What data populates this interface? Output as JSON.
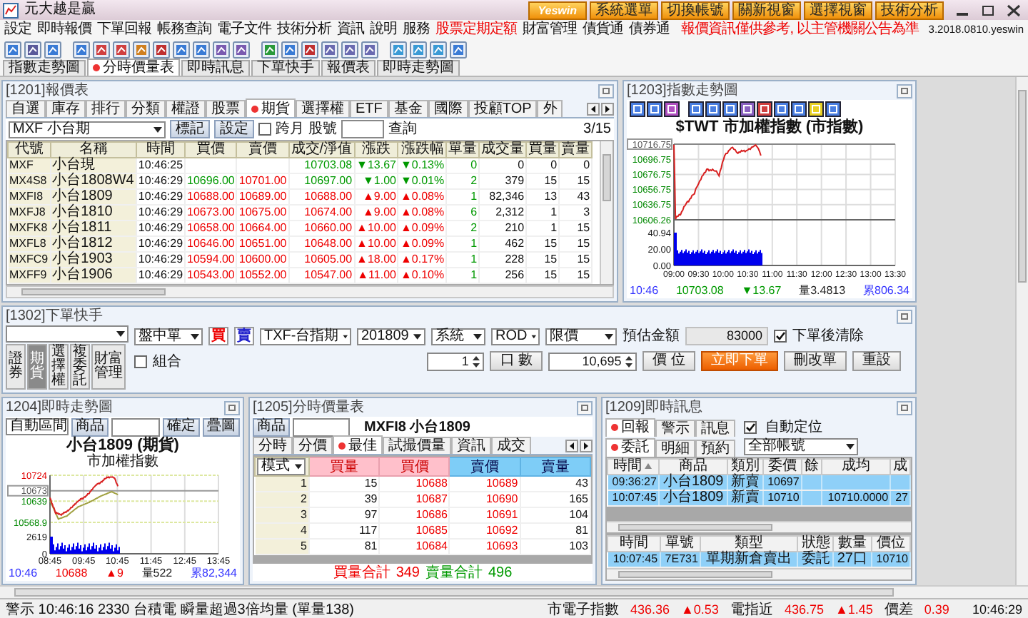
{
  "window": {
    "title": "元大越是贏",
    "logo": "Yeswin",
    "buttons": [
      "系統選單",
      "切換帳號",
      "關新視窗",
      "選擇視窗",
      "技術分析"
    ]
  },
  "menu": [
    {
      "label": "設定",
      "highlight": false
    },
    {
      "label": "即時報價",
      "highlight": false
    },
    {
      "label": "下單回報",
      "highlight": false
    },
    {
      "label": "帳務查詢",
      "highlight": false
    },
    {
      "label": "電子文件",
      "highlight": false
    },
    {
      "label": "技術分析",
      "highlight": false
    },
    {
      "label": "資訊",
      "highlight": false
    },
    {
      "label": "說明",
      "highlight": false
    },
    {
      "label": "服務",
      "highlight": false
    },
    {
      "label": "股票定期定額",
      "highlight": true
    },
    {
      "label": "財富管理",
      "highlight": false
    },
    {
      "label": "債貨通",
      "highlight": false
    },
    {
      "label": "債券通",
      "highlight": false
    }
  ],
  "notice": "報價資訊僅供參考, 以主管機關公告為準",
  "version": "3.2018.0810.yeswin",
  "doc_tabs": [
    {
      "label": "指數走勢圖",
      "selected": false
    },
    {
      "label": "分時價量表",
      "selected": true
    },
    {
      "label": "即時訊息",
      "selected": false
    },
    {
      "label": "下單快手",
      "selected": false
    },
    {
      "label": "報價表",
      "selected": false
    },
    {
      "label": "即時走勢圖",
      "selected": false
    }
  ],
  "quote_panel": {
    "title": "[1201]報價表",
    "tabs": [
      {
        "label": "自選",
        "selected": false
      },
      {
        "label": "庫存",
        "selected": false
      },
      {
        "label": "排行",
        "selected": false
      },
      {
        "label": "分類",
        "selected": false
      },
      {
        "label": "權證",
        "selected": false
      },
      {
        "label": "股票",
        "selected": false
      },
      {
        "label": "期貨",
        "selected": true
      },
      {
        "label": "選擇權",
        "selected": false
      },
      {
        "label": "ETF",
        "selected": false
      },
      {
        "label": "基金",
        "selected": false
      },
      {
        "label": "國際",
        "selected": false
      },
      {
        "label": "投顧TOP",
        "selected": false
      },
      {
        "label": "外",
        "selected": false
      }
    ],
    "product": "MXF 小台期",
    "buttons": [
      "標記",
      "設定"
    ],
    "cross_month": {
      "label": "跨月",
      "checked": false
    },
    "stock_label": "股號",
    "query": "查詢",
    "page": "3/15",
    "columns": [
      "代號",
      "名稱",
      "時間",
      "買價",
      "賣價",
      "成交/淨值",
      "漲跌",
      "漲跌幅",
      "單量",
      "成交量",
      "買量",
      "賣量"
    ],
    "rows": [
      {
        "code": "MXF",
        "name": "小台現",
        "time": "10:46:25",
        "last": "10703.08",
        "change": "▼13.67",
        "change_pct": "▼0.13%",
        "tick_vol": "0",
        "volume": "0",
        "bid_vol": "0",
        "ask_vol": "0",
        "up": false
      },
      {
        "code": "MX4S8",
        "name": "小台1808W4",
        "time": "10:46:29",
        "bid": "10696.00",
        "ask": "10701.00",
        "last": "10697.00",
        "change": "▼1.00",
        "change_pct": "▼0.01%",
        "tick_vol": "2",
        "volume": "379",
        "bid_vol": "15",
        "ask_vol": "15",
        "up": false,
        "bid_up": false,
        "ask_up": true
      },
      {
        "code": "MXFI8",
        "name": "小台1809",
        "time": "10:46:29",
        "bid": "10688.00",
        "ask": "10689.00",
        "last": "10688.00",
        "change": "▲9.00",
        "change_pct": "▲0.08%",
        "tick_vol": "1",
        "volume": "82,346",
        "bid_vol": "13",
        "ask_vol": "43",
        "up": true,
        "bid_up": true,
        "ask_up": true
      },
      {
        "code": "MXFJ8",
        "name": "小台1810",
        "time": "10:46:29",
        "bid": "10673.00",
        "ask": "10675.00",
        "last": "10674.00",
        "change": "▲9.00",
        "change_pct": "▲0.08%",
        "tick_vol": "6",
        "volume": "2,312",
        "bid_vol": "1",
        "ask_vol": "3",
        "up": true,
        "bid_up": true,
        "ask_up": true
      },
      {
        "code": "MXFK8",
        "name": "小台1811",
        "time": "10:46:29",
        "bid": "10658.00",
        "ask": "10664.00",
        "last": "10660.00",
        "change": "▲10.00",
        "change_pct": "▲0.09%",
        "tick_vol": "2",
        "volume": "210",
        "bid_vol": "1",
        "ask_vol": "15",
        "up": true,
        "bid_up": true,
        "ask_up": true
      },
      {
        "code": "MXFL8",
        "name": "小台1812",
        "time": "10:46:29",
        "bid": "10646.00",
        "ask": "10651.00",
        "last": "10648.00",
        "change": "▲10.00",
        "change_pct": "▲0.09%",
        "tick_vol": "1",
        "volume": "462",
        "bid_vol": "15",
        "ask_vol": "15",
        "up": true,
        "bid_up": true,
        "ask_up": true
      },
      {
        "code": "MXFC9",
        "name": "小台1903",
        "time": "10:46:29",
        "bid": "10594.00",
        "ask": "10600.00",
        "last": "10605.00",
        "change": "▲18.00",
        "change_pct": "▲0.17%",
        "tick_vol": "1",
        "volume": "228",
        "bid_vol": "15",
        "ask_vol": "15",
        "up": true,
        "bid_up": true,
        "ask_up": true
      },
      {
        "code": "MXFF9",
        "name": "小台1906",
        "time": "10:46:29",
        "bid": "10543.00",
        "ask": "10552.00",
        "last": "10547.00",
        "change": "▲11.00",
        "change_pct": "▲0.10%",
        "tick_vol": "1",
        "volume": "256",
        "bid_vol": "15",
        "ask_vol": "15",
        "up": true,
        "bid_up": true,
        "ask_up": true
      }
    ]
  },
  "index_chart": {
    "title": "[1203]指數走勢圖",
    "heading": "$TWT 市加權指數 (市指數)",
    "y_labels": [
      {
        "text": "10716.75",
        "boxed": true
      },
      {
        "text": "10696.75",
        "boxed": false,
        "up": false
      },
      {
        "text": "10676.75",
        "boxed": false,
        "up": false
      },
      {
        "text": "10656.75",
        "boxed": false,
        "up": false
      },
      {
        "text": "10636.75",
        "boxed": false,
        "up": false
      },
      {
        "text": "10606.26",
        "boxed": false,
        "up": false
      }
    ],
    "volume_labels": [
      "40.94",
      "20.00",
      "0.00"
    ],
    "x_labels": [
      "09:00",
      "09:30",
      "10:00",
      "10:30",
      "11:00",
      "11:30",
      "12:00",
      "12:30",
      "13:00",
      "13:30"
    ],
    "footer": {
      "time": "10:46",
      "price": "10703.08",
      "change": "▼13.67",
      "up": false,
      "volume": "量3.4813",
      "total": "累806.34"
    }
  },
  "order_panel": {
    "title": "[1302]下單快手",
    "markets": [
      {
        "label": "證券",
        "selected": false
      },
      {
        "label": "期貨",
        "selected": true
      },
      {
        "label": "選擇權",
        "selected": false
      },
      {
        "label": "複委託",
        "selected": false
      },
      {
        "label": "財富管理",
        "selected": false
      }
    ],
    "session": "盤中單",
    "buy": "買",
    "sell": "賣",
    "fields": [
      "TXF-台指期",
      "201809",
      "系統",
      "ROD",
      "限價"
    ],
    "estimate_label": "預估金額",
    "estimate": "83000",
    "clear_after": {
      "label": "下單後清除",
      "checked": true
    },
    "combo": {
      "label": "組合",
      "checked": false
    },
    "qty": "1",
    "qty_label": "口 數",
    "price": "10,695",
    "price_label": "價 位",
    "submit": "立即下單",
    "modify": "刪改單",
    "reset": "重設"
  },
  "trend_chart": {
    "title": "1204]即時走勢圖",
    "range": "自動區間",
    "product_button": "商品",
    "confirm": "確定",
    "overlay": "疊圖",
    "heading": "小台1809 (期貨)",
    "subheading": "市加權指數",
    "y_labels": [
      {
        "text": "10724",
        "boxed": false,
        "up": true
      },
      {
        "text": "10673",
        "boxed": true
      },
      {
        "text": "10639",
        "boxed": false,
        "up": false
      },
      {
        "text": "10568.9",
        "boxed": false,
        "up": false
      }
    ],
    "volume_labels": [
      "2619",
      "0"
    ],
    "x_labels": [
      "08:45",
      "09:45",
      "10:45",
      "11:45",
      "12:45",
      "13:45"
    ],
    "footer": {
      "time": "10:46",
      "price": "10688",
      "change": "▲9",
      "up": true,
      "volume": "量522",
      "total": "累82,344"
    }
  },
  "depth_panel": {
    "title": "[1205]分時價量表",
    "product_button": "商品",
    "product": "MXFI8 小台1809",
    "tabs": [
      {
        "label": "分時",
        "selected": false
      },
      {
        "label": "分價",
        "selected": false
      },
      {
        "label": "最佳",
        "selected": true
      },
      {
        "label": "試撮價量",
        "selected": false
      },
      {
        "label": "資訊",
        "selected": false
      },
      {
        "label": "成交",
        "selected": false
      }
    ],
    "mode": "模式",
    "columns": [
      "買量",
      "買價",
      "賣價",
      "賣量"
    ],
    "rows": [
      {
        "rank": "1",
        "bid_vol": "15",
        "bid": "10688",
        "ask": "10689",
        "ask_vol": "43"
      },
      {
        "rank": "2",
        "bid_vol": "39",
        "bid": "10687",
        "ask": "10690",
        "ask_vol": "165"
      },
      {
        "rank": "3",
        "bid_vol": "97",
        "bid": "10686",
        "ask": "10691",
        "ask_vol": "104"
      },
      {
        "rank": "4",
        "bid_vol": "117",
        "bid": "10685",
        "ask": "10692",
        "ask_vol": "81"
      },
      {
        "rank": "5",
        "bid_vol": "81",
        "bid": "10684",
        "ask": "10693",
        "ask_vol": "103"
      }
    ],
    "buy_total_label": "買量合計",
    "buy_total": "349",
    "sell_total_label": "賣量合計",
    "sell_total": "496"
  },
  "messages_panel": {
    "title": "[1209]即時訊息",
    "tabs": [
      {
        "label": "回報",
        "selected": true
      },
      {
        "label": "警示",
        "selected": false
      },
      {
        "label": "訊息",
        "selected": false
      }
    ],
    "auto_locate": {
      "label": "自動定位",
      "checked": true
    },
    "sub_tabs": [
      {
        "label": "委託",
        "selected": true
      },
      {
        "label": "明細",
        "selected": false
      },
      {
        "label": "預約",
        "selected": false
      }
    ],
    "account": "全部帳號",
    "orders": {
      "columns": [
        "時間",
        "商品",
        "類別",
        "委價",
        "餘",
        "成均",
        "成"
      ],
      "rows": [
        [
          "09:36:27",
          "小台1809",
          "新賣",
          "10697",
          "",
          "",
          ""
        ],
        [
          "10:07:45",
          "小台1809",
          "新賣",
          "10710",
          "",
          "10710.0000",
          "27"
        ]
      ]
    },
    "details": {
      "columns": [
        "時間",
        "單號",
        "類型",
        "狀態",
        "數量",
        "價位"
      ],
      "rows": [
        [
          "10:07:45",
          "7E731",
          "單期新倉賣出",
          "委託",
          "27口",
          "10710"
        ]
      ]
    }
  },
  "status_bar": {
    "message": "警示 10:46:16 2330 台積電 瞬量超過3倍均量 (單量138)",
    "quotes": [
      {
        "label": "市電子指數",
        "value": "436.36",
        "change": "▲0.53"
      },
      {
        "label": "電指近",
        "value": "436.75",
        "change": "▲1.45"
      },
      {
        "label": "價差",
        "value": "0.39"
      }
    ],
    "time": "10:46:29"
  }
}
